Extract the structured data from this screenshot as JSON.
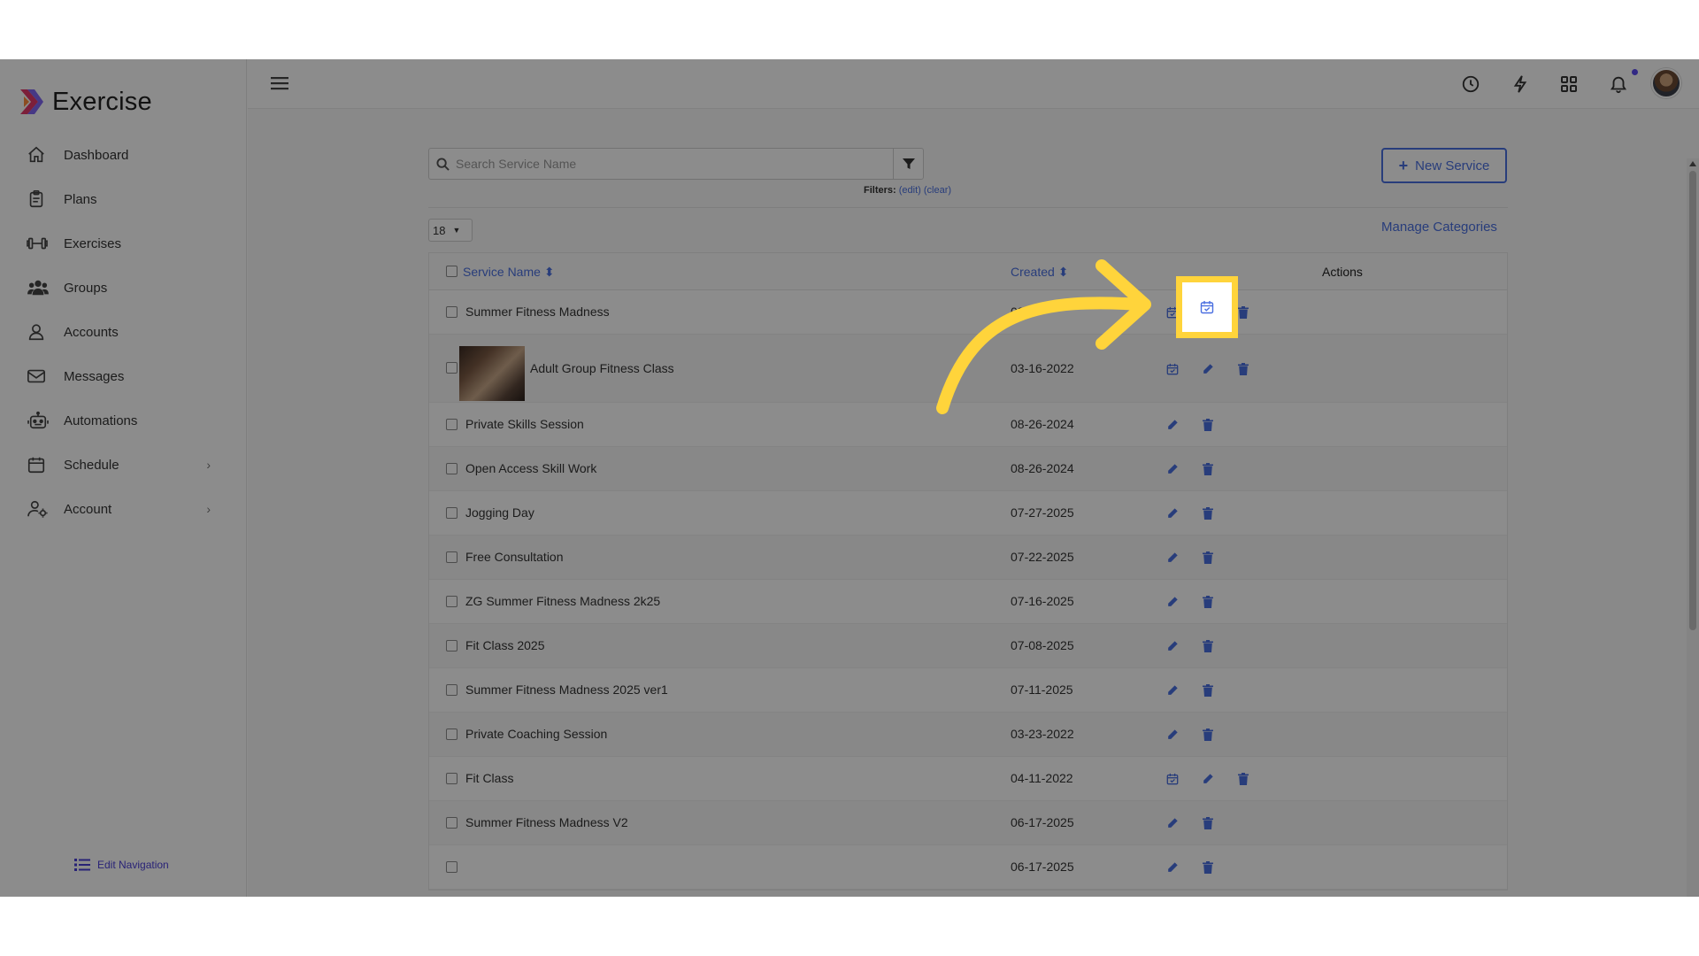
{
  "app": {
    "name": "Exercise"
  },
  "sidebar": {
    "items": [
      {
        "label": "Dashboard",
        "icon": "home-icon"
      },
      {
        "label": "Plans",
        "icon": "clipboard-icon"
      },
      {
        "label": "Exercises",
        "icon": "dumbbell-icon"
      },
      {
        "label": "Groups",
        "icon": "users-icon"
      },
      {
        "label": "Accounts",
        "icon": "user-icon"
      },
      {
        "label": "Messages",
        "icon": "envelope-icon"
      },
      {
        "label": "Automations",
        "icon": "robot-icon"
      },
      {
        "label": "Schedule",
        "icon": "calendar-icon",
        "has_submenu": true
      },
      {
        "label": "Account",
        "icon": "user-gear-icon",
        "has_submenu": true
      }
    ],
    "edit_navigation": "Edit Navigation"
  },
  "header": {
    "icons": [
      "history-icon",
      "bolt-icon",
      "apps-grid-icon",
      "bell-icon"
    ]
  },
  "toolbar": {
    "search_placeholder": "Search Service Name",
    "filters_label": "Filters:",
    "filters_edit": "(edit)",
    "filters_clear": "(clear)",
    "new_service_label": "New Service",
    "page_size": "18",
    "manage_categories": "Manage Categories"
  },
  "table": {
    "columns": {
      "name": "Service Name",
      "created": "Created",
      "actions": "Actions"
    },
    "rows": [
      {
        "name": "Summer Fitness Madness",
        "created": "08",
        "actions": [
          "calendar",
          "edit",
          "delete"
        ]
      },
      {
        "name": "Adult Group Fitness Class",
        "created": "03-16-2022",
        "actions": [
          "calendar",
          "edit",
          "delete"
        ],
        "has_image": true
      },
      {
        "name": "Private Skills Session",
        "created": "08-26-2024",
        "actions": [
          "edit",
          "delete"
        ]
      },
      {
        "name": "Open Access Skill Work",
        "created": "08-26-2024",
        "actions": [
          "edit",
          "delete"
        ]
      },
      {
        "name": "Jogging Day",
        "created": "07-27-2025",
        "actions": [
          "edit",
          "delete"
        ]
      },
      {
        "name": "Free Consultation",
        "created": "07-22-2025",
        "actions": [
          "edit",
          "delete"
        ]
      },
      {
        "name": "ZG Summer Fitness Madness 2k25",
        "created": "07-16-2025",
        "actions": [
          "edit",
          "delete"
        ]
      },
      {
        "name": "Fit Class 2025",
        "created": "07-08-2025",
        "actions": [
          "edit",
          "delete"
        ]
      },
      {
        "name": "Summer Fitness Madness 2025 ver1",
        "created": "07-11-2025",
        "actions": [
          "edit",
          "delete"
        ]
      },
      {
        "name": "Private Coaching Session",
        "created": "03-23-2022",
        "actions": [
          "edit",
          "delete"
        ]
      },
      {
        "name": "Fit Class",
        "created": "04-11-2022",
        "actions": [
          "calendar",
          "edit",
          "delete"
        ]
      },
      {
        "name": "Summer Fitness Madness V2",
        "created": "06-17-2025",
        "actions": [
          "edit",
          "delete"
        ]
      },
      {
        "name": "",
        "created": "06-17-2025",
        "actions": [
          "edit",
          "delete"
        ]
      }
    ]
  },
  "colors": {
    "accent": "#4a6fe0",
    "highlight": "#ffd43b",
    "brand_purple": "#5b4cf0"
  }
}
